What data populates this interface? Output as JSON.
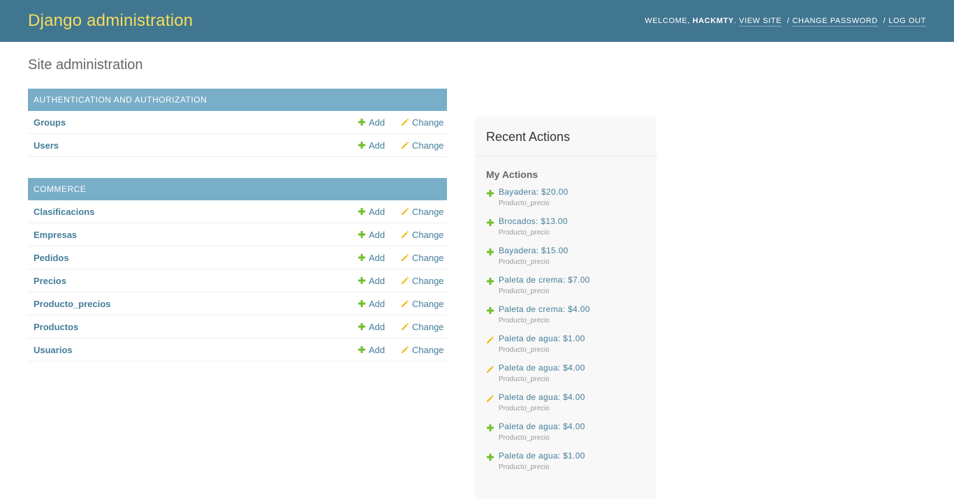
{
  "header": {
    "site_name": "Django administration",
    "welcome_prefix": "Welcome,",
    "username": "hackmty",
    "after_username": ".",
    "view_site": "View site",
    "change_password": "Change password",
    "log_out": "Log out",
    "separator": "/"
  },
  "page_title": "Site administration",
  "links": {
    "add": "Add",
    "change": "Change"
  },
  "apps": [
    {
      "caption": "Authentication and Authorization",
      "models": [
        "Groups",
        "Users"
      ]
    },
    {
      "caption": "Commerce",
      "models": [
        "Clasificacions",
        "Empresas",
        "Pedidos",
        "Precios",
        "Producto_precios",
        "Productos",
        "Usuarios"
      ]
    }
  ],
  "sidebar": {
    "title": "Recent Actions",
    "subtitle": "My Actions",
    "actions": [
      {
        "icon": "add-icon",
        "label": "Bayadera: $20.00",
        "type": "Producto_precio"
      },
      {
        "icon": "add-icon",
        "label": "Brocados: $13.00",
        "type": "Producto_precio"
      },
      {
        "icon": "add-icon",
        "label": "Bayadera: $15.00",
        "type": "Producto_precio"
      },
      {
        "icon": "add-icon",
        "label": "Paleta de crema: $7.00",
        "type": "Producto_precio"
      },
      {
        "icon": "add-icon",
        "label": "Paleta de crema: $4.00",
        "type": "Producto_precio"
      },
      {
        "icon": "pencil-icon",
        "label": "Paleta de agua: $1.00",
        "type": "Producto_precio"
      },
      {
        "icon": "pencil-icon",
        "label": "Paleta de agua: $4.00",
        "type": "Producto_precio"
      },
      {
        "icon": "pencil-icon",
        "label": "Paleta de agua: $4.00",
        "type": "Producto_precio"
      },
      {
        "icon": "add-icon",
        "label": "Paleta de agua: $4.00",
        "type": "Producto_precio"
      },
      {
        "icon": "add-icon",
        "label": "Paleta de agua: $1.00",
        "type": "Producto_precio"
      }
    ]
  },
  "colors": {
    "header_bg": "#417690",
    "site_name": "#f5dd5d",
    "module_caption_bg": "#79aec8",
    "link": "#447e9b",
    "add_icon": "#70bf2b",
    "change_icon": "#efb80b"
  }
}
